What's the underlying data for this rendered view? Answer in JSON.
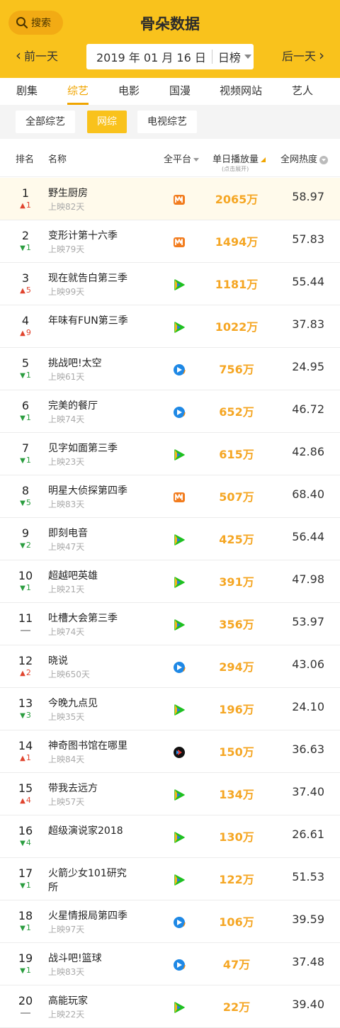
{
  "header": {
    "search_label": "搜索",
    "title": "骨朵数据",
    "prev_label": "前一天",
    "next_label": "后一天",
    "date": "2019 年 01 月 16 日",
    "period": "日榜"
  },
  "tabs": [
    "剧集",
    "综艺",
    "电影",
    "国漫",
    "视频网站",
    "艺人"
  ],
  "active_tab": "综艺",
  "filters": [
    "全部综艺",
    "网综",
    "电视综艺"
  ],
  "active_filter": "网综",
  "columns": {
    "rank": "排名",
    "name": "名称",
    "platform": "全平台",
    "plays": "单日播放量",
    "plays_hint": "(点击展开)",
    "heat": "全网热度"
  },
  "colors": {
    "accent": "#f9c21c",
    "accent_dark": "#f0a500",
    "up": "#e0442e",
    "down": "#2a9d3f"
  },
  "rows": [
    {
      "rank": "1",
      "dir": "up",
      "chg": "1",
      "name": "野生厨房",
      "sub": "上映82天",
      "platform": "mango-icon",
      "plays": "2065万",
      "heat": "58.97"
    },
    {
      "rank": "2",
      "dir": "down",
      "chg": "1",
      "name": "变形计第十六季",
      "sub": "上映79天",
      "platform": "mango-icon",
      "plays": "1494万",
      "heat": "57.83"
    },
    {
      "rank": "3",
      "dir": "up",
      "chg": "5",
      "name": "现在就告白第三季",
      "sub": "上映99天",
      "platform": "iqiyi-icon",
      "plays": "1181万",
      "heat": "55.44"
    },
    {
      "rank": "4",
      "dir": "up",
      "chg": "9",
      "name": "年味有FUN第三季",
      "sub": "",
      "platform": "iqiyi-icon",
      "plays": "1022万",
      "heat": "37.83"
    },
    {
      "rank": "5",
      "dir": "down",
      "chg": "1",
      "name": "挑战吧!太空",
      "sub": "上映61天",
      "platform": "tencent-icon",
      "plays": "756万",
      "heat": "24.95"
    },
    {
      "rank": "6",
      "dir": "down",
      "chg": "1",
      "name": "完美的餐厅",
      "sub": "上映74天",
      "platform": "tencent-icon",
      "plays": "652万",
      "heat": "46.72"
    },
    {
      "rank": "7",
      "dir": "down",
      "chg": "1",
      "name": "见字如面第三季",
      "sub": "上映23天",
      "platform": "iqiyi-icon",
      "plays": "615万",
      "heat": "42.86"
    },
    {
      "rank": "8",
      "dir": "down",
      "chg": "5",
      "name": "明星大侦探第四季",
      "sub": "上映83天",
      "platform": "mango-icon",
      "plays": "507万",
      "heat": "68.40"
    },
    {
      "rank": "9",
      "dir": "down",
      "chg": "2",
      "name": "即刻电音",
      "sub": "上映47天",
      "platform": "iqiyi-icon",
      "plays": "425万",
      "heat": "56.44"
    },
    {
      "rank": "10",
      "dir": "down",
      "chg": "1",
      "name": "超越吧英雄",
      "sub": "上映21天",
      "platform": "iqiyi-icon",
      "plays": "391万",
      "heat": "47.98"
    },
    {
      "rank": "11",
      "dir": "flat",
      "chg": "",
      "name": "吐槽大会第三季",
      "sub": "上映74天",
      "platform": "iqiyi-icon",
      "plays": "356万",
      "heat": "53.97"
    },
    {
      "rank": "12",
      "dir": "up",
      "chg": "2",
      "name": "晓说",
      "sub": "上映650天",
      "platform": "tencent-icon",
      "plays": "294万",
      "heat": "43.06"
    },
    {
      "rank": "13",
      "dir": "down",
      "chg": "3",
      "name": "今晚九点见",
      "sub": "上映35天",
      "platform": "iqiyi-icon",
      "plays": "196万",
      "heat": "24.10"
    },
    {
      "rank": "14",
      "dir": "up",
      "chg": "1",
      "name": "神奇图书馆在哪里",
      "sub": "上映84天",
      "platform": "youku-icon",
      "plays": "150万",
      "heat": "36.63"
    },
    {
      "rank": "15",
      "dir": "up",
      "chg": "4",
      "name": "带我去远方",
      "sub": "上映57天",
      "platform": "iqiyi-icon",
      "plays": "134万",
      "heat": "37.40"
    },
    {
      "rank": "16",
      "dir": "down",
      "chg": "4",
      "name": "超级演说家2018",
      "sub": "",
      "platform": "iqiyi-icon",
      "plays": "130万",
      "heat": "26.61"
    },
    {
      "rank": "17",
      "dir": "down",
      "chg": "1",
      "name": "火箭少女101研究所",
      "sub": "",
      "platform": "iqiyi-icon",
      "plays": "122万",
      "heat": "51.53"
    },
    {
      "rank": "18",
      "dir": "down",
      "chg": "1",
      "name": "火星情报局第四季",
      "sub": "上映97天",
      "platform": "tencent-icon",
      "plays": "106万",
      "heat": "39.59"
    },
    {
      "rank": "19",
      "dir": "down",
      "chg": "1",
      "name": "战斗吧!篮球",
      "sub": "上映83天",
      "platform": "tencent-icon",
      "plays": "47万",
      "heat": "37.48"
    },
    {
      "rank": "20",
      "dir": "flat",
      "chg": "",
      "name": "高能玩家",
      "sub": "上映22天",
      "platform": "iqiyi-icon",
      "plays": "22万",
      "heat": "39.40"
    }
  ]
}
